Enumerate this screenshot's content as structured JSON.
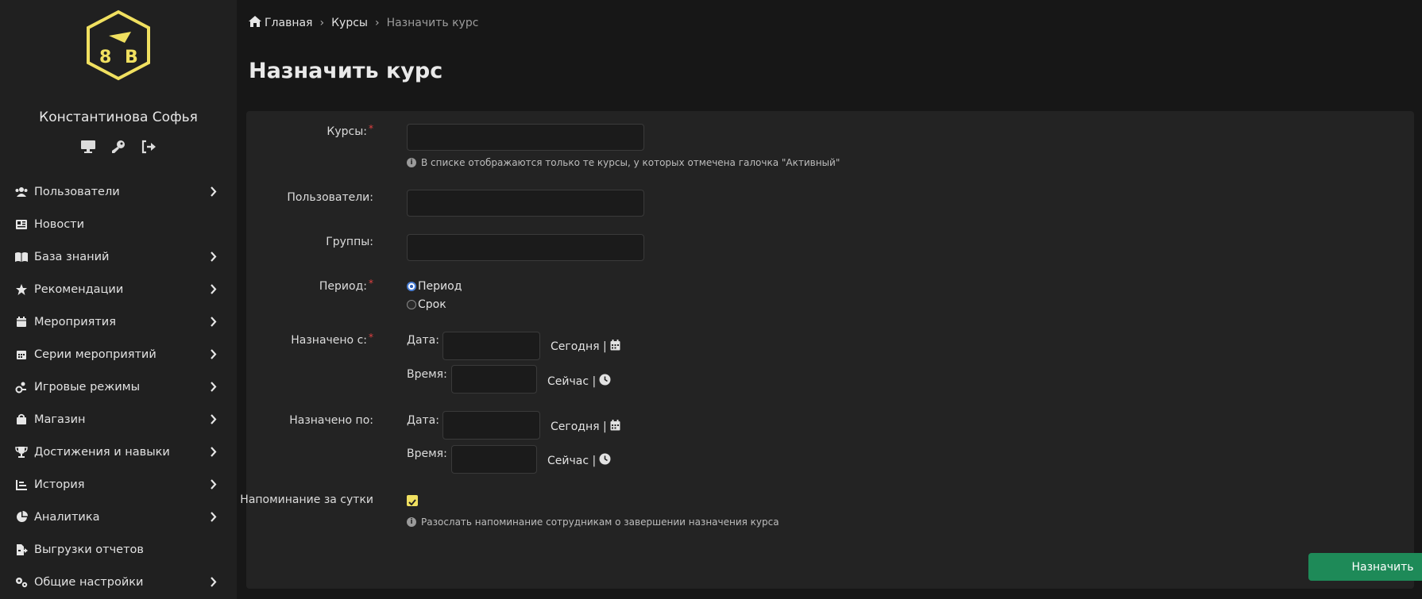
{
  "sidebar": {
    "user_name": "Константинова Софья",
    "tools": [
      "monitor-icon",
      "key-icon",
      "logout-icon"
    ],
    "items": [
      {
        "label": "Пользователи",
        "icon": "users-icon",
        "chevron": true
      },
      {
        "label": "Новости",
        "icon": "newspaper-icon",
        "chevron": false
      },
      {
        "label": "База знаний",
        "icon": "book-icon",
        "chevron": true
      },
      {
        "label": "Рекомендации",
        "icon": "star-icon",
        "chevron": true
      },
      {
        "label": "Мероприятия",
        "icon": "calendar-icon",
        "chevron": true
      },
      {
        "label": "Серии мероприятий",
        "icon": "calendar-grid-icon",
        "chevron": true
      },
      {
        "label": "Игровые режимы",
        "icon": "game-icon",
        "chevron": true
      },
      {
        "label": "Магазин",
        "icon": "bag-icon",
        "chevron": true
      },
      {
        "label": "Достижения и навыки",
        "icon": "trophy-icon",
        "chevron": true
      },
      {
        "label": "История",
        "icon": "history-chart-icon",
        "chevron": true
      },
      {
        "label": "Аналитика",
        "icon": "pie-chart-icon",
        "chevron": true
      },
      {
        "label": "Выгрузки отчетов",
        "icon": "file-export-icon",
        "chevron": false
      },
      {
        "label": "Общие настройки",
        "icon": "gears-icon",
        "chevron": true
      }
    ]
  },
  "breadcrumb": {
    "home": "Главная",
    "courses": "Курсы",
    "current": "Назначить курс",
    "separator": "›"
  },
  "page_title": "Назначить курс",
  "form": {
    "courses_label": "Курсы:",
    "courses_hint": "В списке отображаются только те курсы, у которых отмечена галочка \"Активный\"",
    "users_label": "Пользователи:",
    "groups_label": "Группы:",
    "period_label": "Период:",
    "period_options": [
      "Период",
      "Срок"
    ],
    "period_selected": "Период",
    "assigned_from_label": "Назначено с:",
    "assigned_to_label": "Назначено по:",
    "date_label": "Дата:",
    "time_label": "Время:",
    "today_link": "Сегодня |",
    "now_link": "Сейчас |",
    "reminder_label": "Напоминание за сутки",
    "reminder_checked": true,
    "reminder_hint": "Разослать напоминание сотрудникам о завершении назначения курса",
    "required_mark": "*",
    "info_mark": "i",
    "submit_label": "Назначить"
  },
  "colors": {
    "accent_yellow": "#f0e060",
    "submit_green": "#1e8a58",
    "required_red": "#e04040"
  }
}
